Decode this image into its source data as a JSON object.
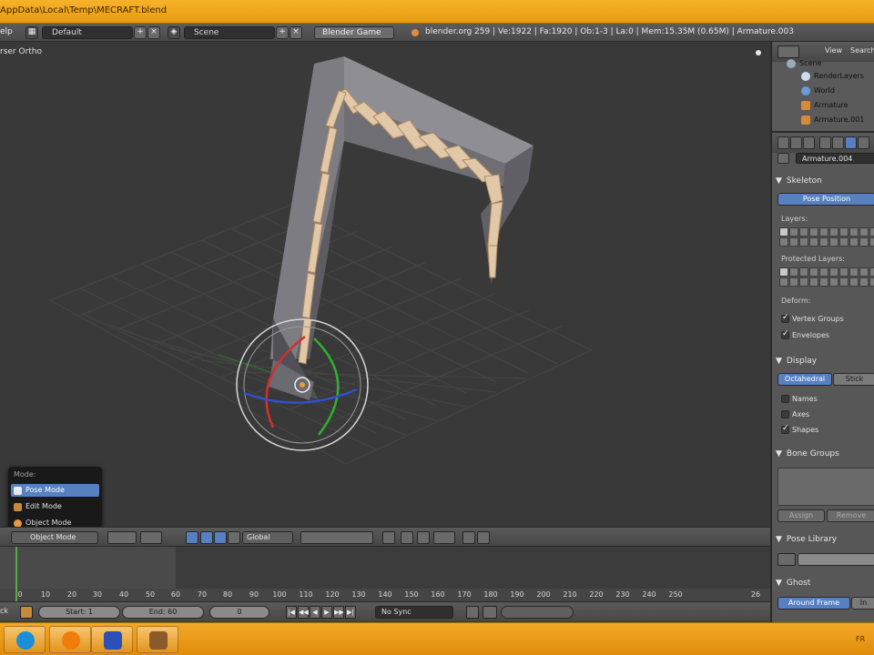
{
  "window": {
    "title": "AppData\\Local\\Temp\\MECRAFT.blend"
  },
  "infobar": {
    "help_menu": "elp",
    "screen_layout": "Default",
    "scene_name": "Scene",
    "render_engine": "Blender Game",
    "stats": "blender.org 259 | Ve:1922 | Fa:1920 | Ob:1-3 | La:0 | Mem:15.35M (0.65M) | Armature.003"
  },
  "viewport": {
    "label": "rser Ortho"
  },
  "mode_menu": {
    "header": "Mode:",
    "items": [
      {
        "label": "Pose Mode",
        "selected": true,
        "icon": "pose-mode-icon"
      },
      {
        "label": "Edit Mode",
        "selected": false,
        "icon": "edit-mode-icon"
      },
      {
        "label": "Object Mode",
        "selected": false,
        "icon": "object-mode-icon"
      }
    ]
  },
  "view_header": {
    "mode_select": "Object Mode",
    "orientation": "Global"
  },
  "timeline": {
    "frame_numbers": [
      "0",
      "10",
      "20",
      "30",
      "40",
      "50",
      "60",
      "70",
      "80",
      "90",
      "100",
      "110",
      "120",
      "130",
      "140",
      "150",
      "160",
      "170",
      "180",
      "190",
      "200",
      "210",
      "220",
      "230",
      "240",
      "250",
      "26"
    ],
    "start_label": "Start: 1",
    "end_label": "End: 60",
    "current_frame": "0",
    "sync": "No Sync",
    "left_label": "ck"
  },
  "outliner": {
    "view_menu": "View",
    "search_menu": "Search",
    "items": [
      {
        "label": "Scene"
      },
      {
        "label": "RenderLayers"
      },
      {
        "label": "World"
      },
      {
        "label": "Armature"
      },
      {
        "label": "Armature.001"
      }
    ]
  },
  "properties": {
    "object_name": "Armature.004",
    "skeleton": {
      "section": "Skeleton",
      "pose_position": "Pose Position",
      "layers_label": "Layers:",
      "protected_label": "Protected Layers:",
      "deform_label": "Deform:",
      "vertex_groups": "Vertex Groups",
      "envelopes": "Envelopes"
    },
    "display": {
      "section": "Display",
      "octahedral": "Octahedral",
      "stick": "Stick",
      "names": "Names",
      "axes": "Axes",
      "shapes": "Shapes"
    },
    "bone_groups": {
      "section": "Bone Groups",
      "assign": "Assign",
      "remove": "Remove"
    },
    "pose_library": {
      "section": "Pose Library"
    },
    "ghost": {
      "section": "Ghost",
      "around_frame": "Around Frame",
      "in_range": "In"
    }
  },
  "taskbar": {
    "language": "FR",
    "apps": [
      {
        "icon": "skype-icon",
        "color": "#1a8fd8"
      },
      {
        "icon": "blender-icon",
        "color": "#f07c0a"
      },
      {
        "icon": "app-blue-icon",
        "color": "#2d4fb8"
      },
      {
        "icon": "tool-icon",
        "color": "#8a5a2a"
      }
    ]
  }
}
